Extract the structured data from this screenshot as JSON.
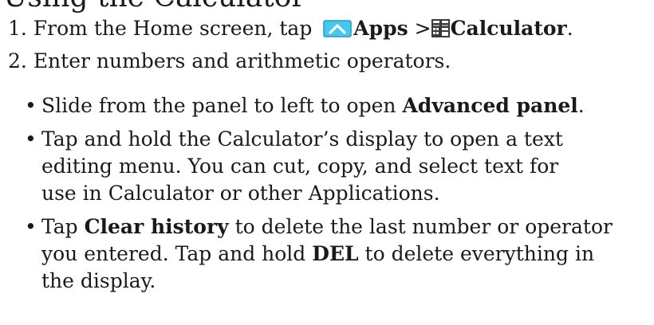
{
  "heading_partial": "Using the Calculator",
  "steps": [
    {
      "number": "1.",
      "text_before": "From the Home screen, tap",
      "apps_label": "Apps",
      "separator": ">",
      "calculator_label": "Calculator",
      "text_after": "."
    },
    {
      "number": "2.",
      "text": "Enter numbers and arithmetic operators."
    }
  ],
  "bullet_symbol": "•",
  "bullets": [
    {
      "line1_before": "Slide from the panel to left to open",
      "line1_bold": "Advanced panel",
      "line1_after": "."
    },
    {
      "line1": "Tap and hold the Calculator’s display to open a text",
      "line2": "editing menu. You can cut, copy, and select text for",
      "line3": "use in Calculator or other Applications."
    },
    {
      "line1_before": "Tap",
      "line1_bold": "Clear history",
      "line1_after": "to delete the last number or operator",
      "line2_before": "you entered. Tap and hold",
      "line2_bold": "DEL",
      "line2_after": "to delete everything in",
      "line3": "the display."
    }
  ],
  "icons": {
    "apps": "apps-chevron-up-icon",
    "calculator": "calculator-icon"
  },
  "colors": {
    "apps_icon_fill": "#44c8ec",
    "apps_icon_border": "#1e9cc8",
    "calculator_icon": "#3a3a3a",
    "text": "#1a1a1a"
  }
}
